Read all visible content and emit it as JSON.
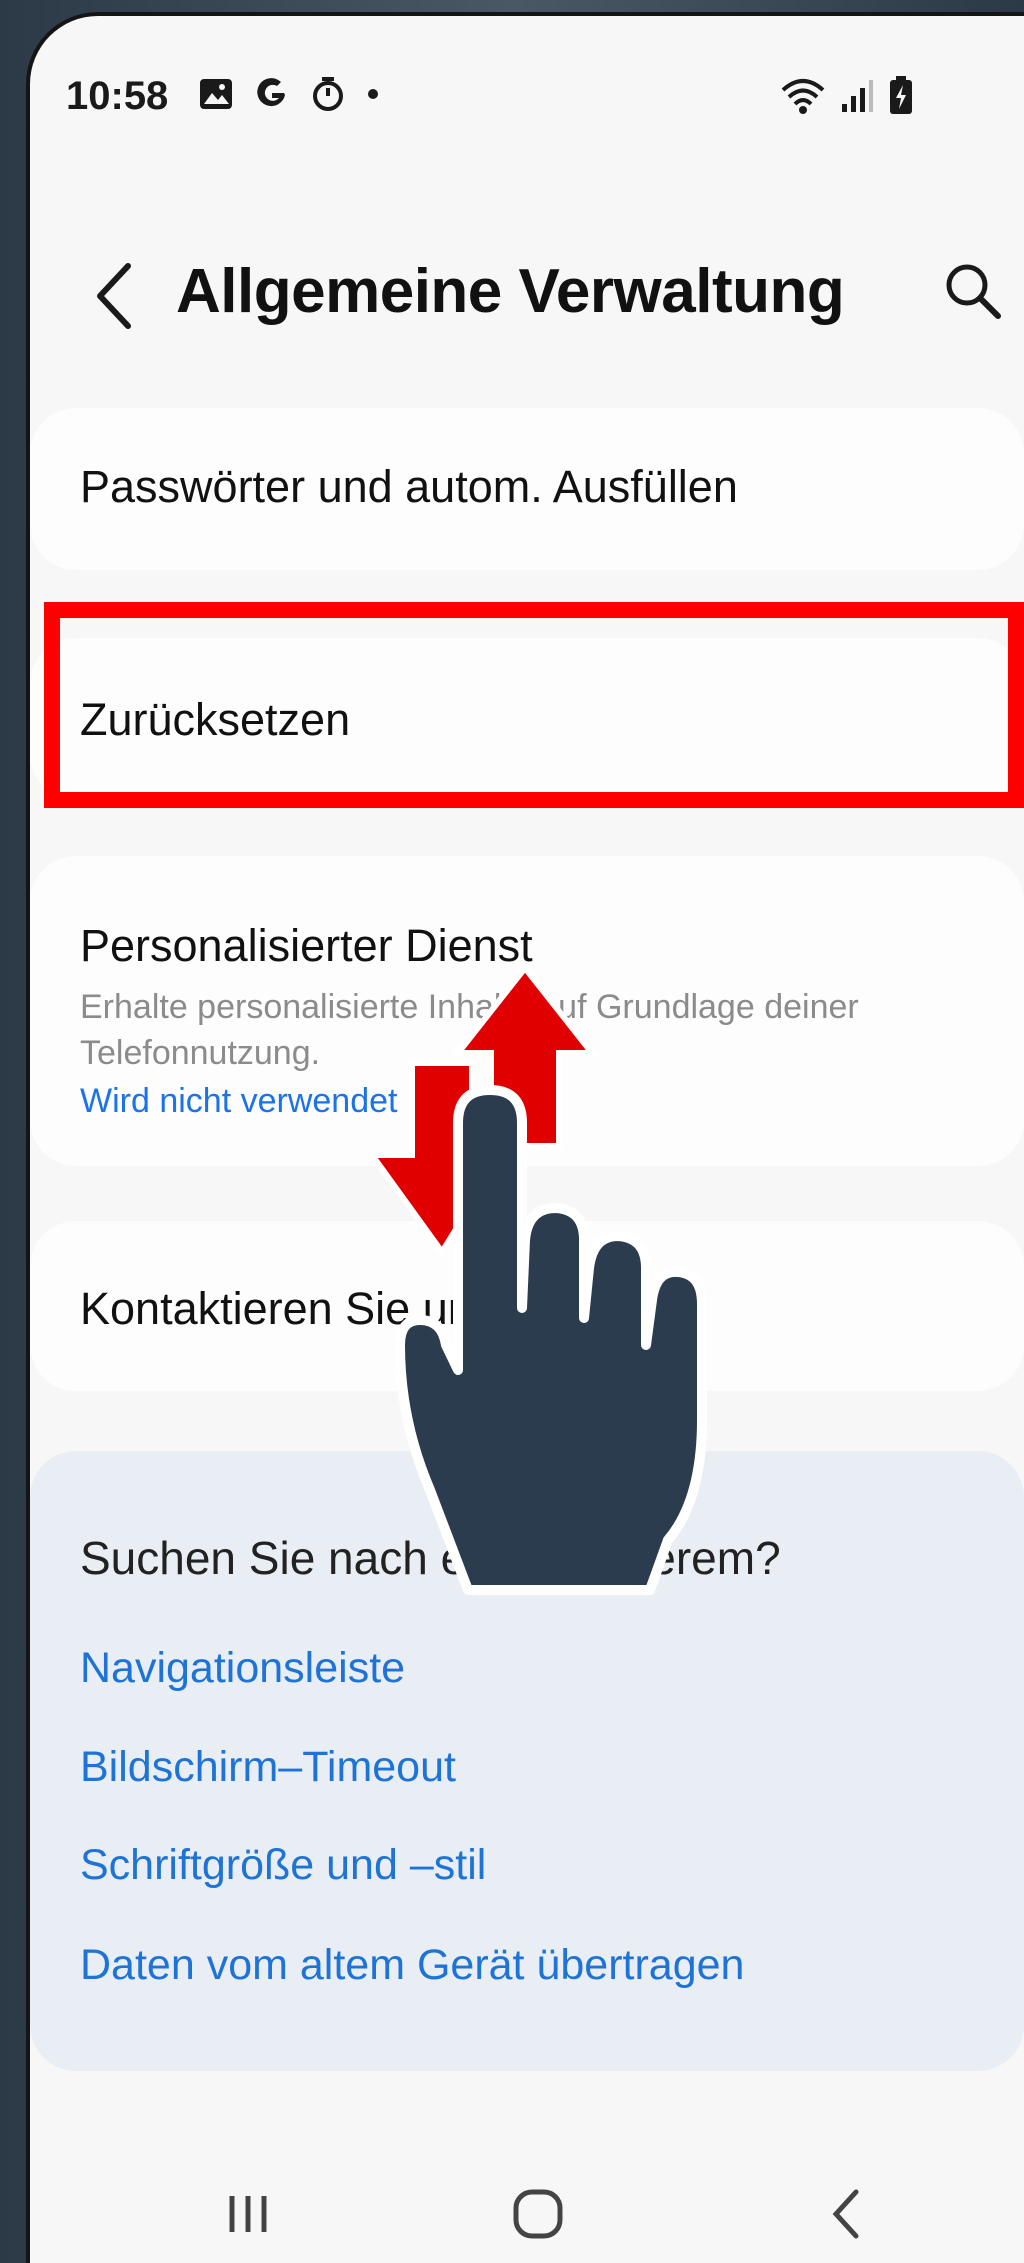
{
  "status_bar": {
    "time": "10:58"
  },
  "header": {
    "title": "Allgemeine Verwaltung"
  },
  "settings": [
    {
      "title": "Passwörter und autom. Ausfüllen"
    },
    {
      "title": "Zurücksetzen"
    },
    {
      "title": "Personalisierter Dienst",
      "subtitle": "Erhalte personalisierte Inhalte auf Grundlage deiner Telefonnutzung.",
      "status": "Wird nicht verwendet"
    },
    {
      "title": "Kontaktieren Sie uns"
    }
  ],
  "suggestions": {
    "heading": "Suchen Sie nach etwas anderem?",
    "links": [
      "Navigationsleiste",
      "Bildschirm–Timeout",
      "Schriftgröße und –stil",
      "Daten vom altem Gerät übertragen"
    ]
  },
  "colors": {
    "highlight": "#ff0000",
    "link": "#1a73e8",
    "gesture_hand": "#2b3c4f",
    "gesture_arrows": "#e00000"
  },
  "icons": {
    "status": [
      "gallery-icon",
      "google-icon",
      "timer-icon",
      "dot-icon",
      "wifi-icon",
      "signal-icon",
      "battery-icon"
    ],
    "nav": [
      "recents-icon",
      "home-icon",
      "back-icon"
    ],
    "overlay": [
      "swipe-hand-icon",
      "swipe-up-arrow-icon",
      "swipe-down-arrow-icon"
    ]
  }
}
